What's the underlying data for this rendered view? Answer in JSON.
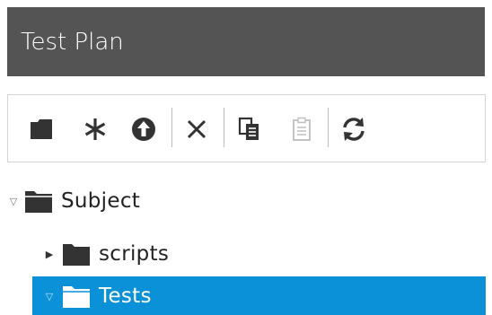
{
  "header": {
    "title": "Test Plan"
  },
  "toolbar": {
    "buttons": [
      {
        "name": "new-folder",
        "icon": "folder-icon"
      },
      {
        "name": "new-test",
        "icon": "asterisk-icon"
      },
      {
        "name": "upload",
        "icon": "arrow-up-circle-icon"
      },
      {
        "name": "delete",
        "icon": "close-icon"
      },
      {
        "name": "copy",
        "icon": "copy-icon"
      },
      {
        "name": "paste",
        "icon": "paste-icon",
        "disabled": true
      },
      {
        "name": "refresh",
        "icon": "refresh-icon"
      }
    ]
  },
  "tree": {
    "items": [
      {
        "label": "Subject",
        "expanded": true,
        "level": 0
      },
      {
        "label": "scripts",
        "expanded": false,
        "level": 1
      },
      {
        "label": "Tests",
        "expanded": true,
        "level": 1,
        "selected": true
      }
    ]
  },
  "colors": {
    "header_bg": "#545454",
    "selection": "#0a91d8",
    "icon": "#333333",
    "icon_disabled": "#bdbdbd"
  }
}
